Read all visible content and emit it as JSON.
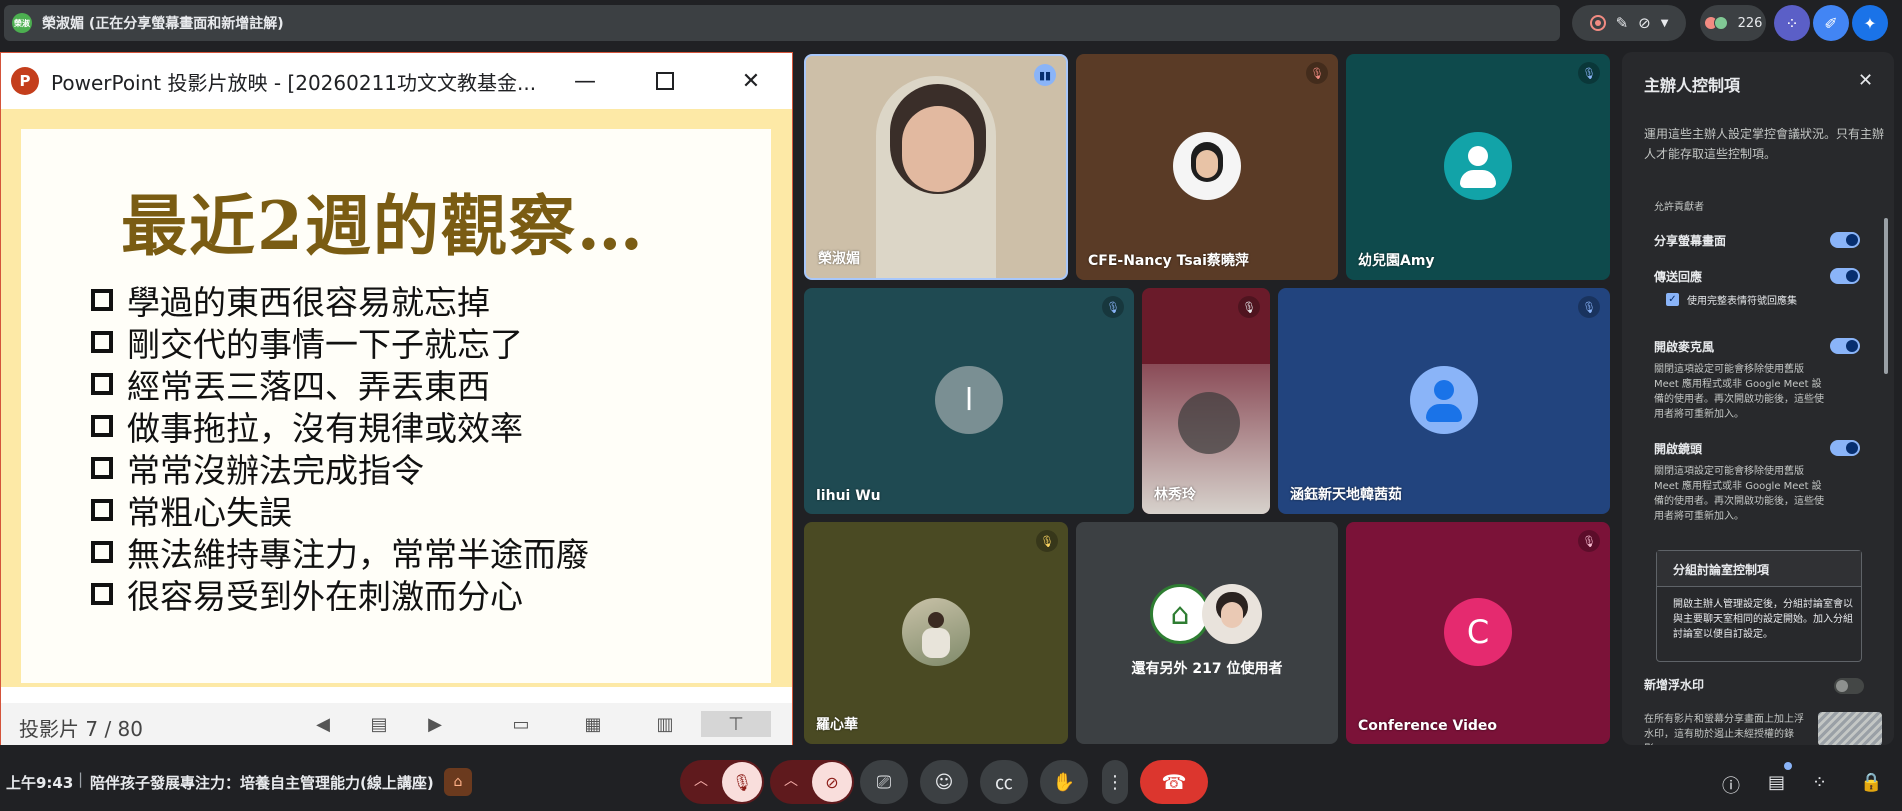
{
  "topbar": {
    "share_avatar_text": "榮淑",
    "share_status": "榮淑媚 (正在分享螢幕畫面和新增註解)",
    "participant_count": "226",
    "icons": [
      "record-icon",
      "annotate-icon",
      "camera-off-icon",
      "chevron-down-icon",
      "people-icon",
      "apps-icon",
      "pen-icon",
      "gemini-icon"
    ],
    "colors": {
      "banner": "#3c4043",
      "accent_blue": "#8ab4f8"
    }
  },
  "presentation": {
    "app_logo": "P",
    "window_title": "PowerPoint 投影片放映 - [20260211功文文教基金...",
    "slide_heading": "最近2週的觀察…",
    "slide_items": [
      "學過的東西很容易就忘掉",
      "剛交代的事情一下子就忘了",
      "經常丟三落四、弄丟東西",
      "做事拖拉，沒有規律或效率",
      "常常沒辦法完成指令",
      "常粗心失誤",
      "無法維持專注力，常常半途而廢",
      "很容易受到外在刺激而分心"
    ],
    "slide_counter": "投影片 7 / 80",
    "colors": {
      "frame": "#fde9a6",
      "heading": "#7a5c13",
      "border": "#d4543a"
    }
  },
  "tiles": [
    {
      "name": "榮淑媚",
      "mic": "speaking"
    },
    {
      "name": "CFE-Nancy Tsai蔡曉萍",
      "mic": "muted"
    },
    {
      "name": "幼兒園Amy",
      "mic": "muted"
    },
    {
      "name": "lihui Wu",
      "mic": "muted",
      "initial": "l"
    },
    {
      "name": "林秀玲",
      "mic": "muted"
    },
    {
      "name": "涵鈺新天地韓茜茹",
      "mic": "muted"
    },
    {
      "name": "羅心華",
      "mic": "muted"
    },
    {
      "name": "還有另外 217 位使用者"
    },
    {
      "name": "Conference Video",
      "mic": "muted",
      "initial": "C"
    }
  ],
  "host_panel": {
    "title": "主辦人控制項",
    "description": "運用這些主辦人設定掌控會議狀況。只有主辦人才能存取這些控制項。",
    "section_label": "允許貢獻者",
    "share_screen": "分享螢幕畫面",
    "send_reactions": "傳送回應",
    "full_emoji": "使用完整表情符號回應集",
    "mic_label": "開啟麥克風",
    "mic_desc": "關閉這項設定可能會移除使用舊版 Meet 應用程式或非 Google Meet 設備的使用者。再次開啟功能後，這些使用者將可重新加入。",
    "camera_label": "開啟鏡頭",
    "camera_desc": "關閉這項設定可能會移除使用舊版 Meet 應用程式或非 Google Meet 設備的使用者。再次開啟功能後，這些使用者將可重新加入。",
    "breakout_title": "分組討論室控制項",
    "breakout_desc": "開啟主辦人管理設定後，分組討論室會以與主要聊天室相同的設定開始。加入分組討論室以便自訂設定。",
    "watermark_label": "新增浮水印",
    "watermark_desc": "在所有影片和螢幕分享畫面上加上浮水印，這有助於遏止未經授權的錄影..."
  },
  "bottombar": {
    "time": "上午9:43",
    "separator": "|",
    "meeting_name": "陪伴孩子發展專注力：培養自主管理能力(線上講座)",
    "badge_icon": "host-badge-icon",
    "colors": {
      "end_call": "#dc362e",
      "muted": "#5f1a1d"
    }
  }
}
